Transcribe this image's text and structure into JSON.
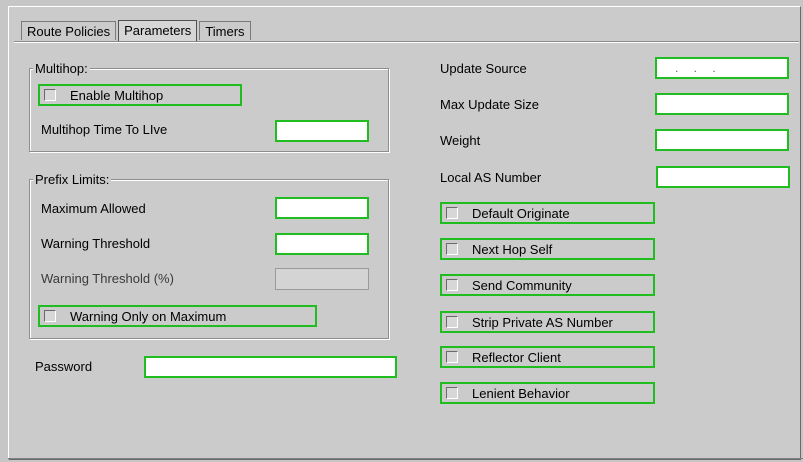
{
  "tabs": [
    {
      "label": "Route Policies"
    },
    {
      "label": "Parameters"
    },
    {
      "label": "Timers"
    }
  ],
  "multihop": {
    "title": "Multihop:",
    "enable_label": "Enable Multihop",
    "enable_checked": false,
    "ttl_label": "Multihop Time To LIve",
    "ttl_value": ""
  },
  "prefix_limits": {
    "title": "Prefix Limits:",
    "max_allowed_label": "Maximum Allowed",
    "max_allowed_value": "",
    "warn_threshold_label": "Warning Threshold",
    "warn_threshold_value": "",
    "warn_pct_label": "Warning Threshold (%)",
    "warn_pct_value": "",
    "warn_only_label": "Warning Only on Maximum",
    "warn_only_checked": false
  },
  "password": {
    "label": "Password",
    "value": ""
  },
  "right": {
    "update_source_label": "Update Source",
    "update_source_value": ". . .",
    "max_update_size_label": "Max Update Size",
    "max_update_size_value": "",
    "weight_label": "Weight",
    "weight_value": "",
    "local_as_label": "Local AS Number",
    "local_as_value": ""
  },
  "options": [
    {
      "label": "Default Originate",
      "checked": false
    },
    {
      "label": "Next Hop Self",
      "checked": false
    },
    {
      "label": "Send Community",
      "checked": false
    },
    {
      "label": "Strip Private AS Number",
      "checked": false
    },
    {
      "label": "Reflector Client",
      "checked": false
    },
    {
      "label": "Lenient Behavior",
      "checked": false
    }
  ]
}
